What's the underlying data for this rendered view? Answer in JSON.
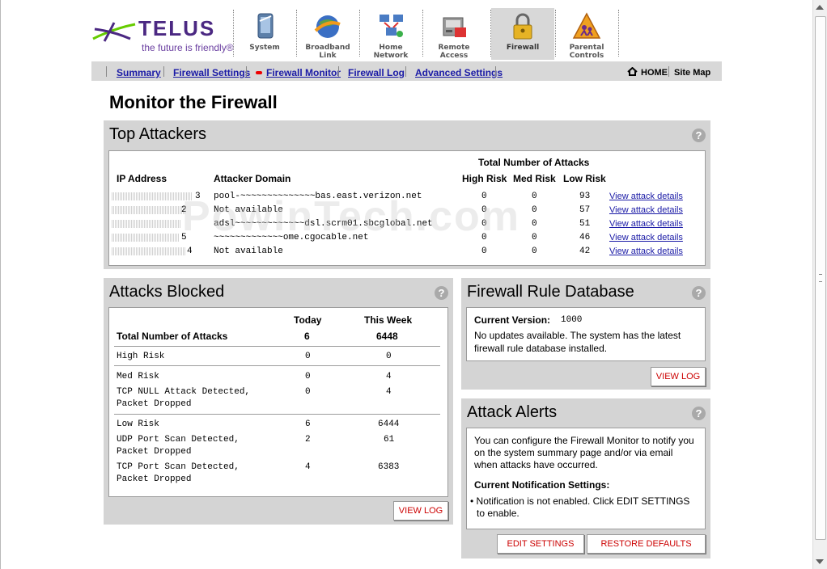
{
  "brand": {
    "name": "TELUS",
    "tagline": "the future is friendly®"
  },
  "main_nav": [
    {
      "label1": "System",
      "label2": "",
      "icon": "system-icon"
    },
    {
      "label1": "Broadband",
      "label2": "Link",
      "icon": "globe-icon"
    },
    {
      "label1": "Home",
      "label2": "Network",
      "icon": "network-icon"
    },
    {
      "label1": "Remote",
      "label2": "Access",
      "icon": "remote-icon"
    },
    {
      "label1": "Firewall",
      "label2": "",
      "icon": "lock-icon"
    },
    {
      "label1": "Parental",
      "label2": "Controls",
      "icon": "warning-icon"
    }
  ],
  "sub_nav": {
    "items": [
      "Summary",
      "Firewall Settings",
      "Firewall Monitor",
      "Firewall Log",
      "Advanced Settings"
    ],
    "home": "HOME",
    "sitemap": "Site Map"
  },
  "page_title": "Monitor the Firewall",
  "watermark": "PowinTech.com",
  "top_attackers": {
    "title": "Top Attackers",
    "help": "?",
    "group_header": "Total Number of Attacks",
    "col_ip": "IP Address",
    "col_domain": "Attacker Domain",
    "col_high": "High Risk",
    "col_med": "Med Risk",
    "col_low": "Low Risk",
    "rows": [
      {
        "ip_tail": "3",
        "domain": "pool-~~~~~~~~~~~~~~bas.east.verizon.net",
        "high": "0",
        "med": "0",
        "low": "93",
        "link": "View attack details"
      },
      {
        "ip_tail": "2",
        "domain": "Not available",
        "high": "0",
        "med": "0",
        "low": "57",
        "link": "View attack details"
      },
      {
        "ip_tail": "",
        "domain": "adsl~~~~~~~~~~~~~dsl.scrm01.sbcglobal.net",
        "high": "0",
        "med": "0",
        "low": "51",
        "link": "View attack details"
      },
      {
        "ip_tail": "5",
        "domain": "~~~~~~~~~~~~~ome.cgocable.net",
        "high": "0",
        "med": "0",
        "low": "46",
        "link": "View attack details"
      },
      {
        "ip_tail": "4",
        "domain": "Not available",
        "high": "0",
        "med": "0",
        "low": "42",
        "link": "View attack details"
      }
    ]
  },
  "attacks_blocked": {
    "title": "Attacks Blocked",
    "help": "?",
    "col_today": "Today",
    "col_week": "This Week",
    "total_label": "Total Number of Attacks",
    "total_today": "6",
    "total_week": "6448",
    "high_label": "High Risk",
    "high_today": "0",
    "high_week": "0",
    "med_label": "Med Risk",
    "med_today": "0",
    "med_week": "4",
    "tcp_null_1": "TCP NULL Attack Detected,",
    "tcp_null_2": "Packet Dropped",
    "tcp_null_today": "0",
    "tcp_null_week": "4",
    "low_label": "Low Risk",
    "low_today": "6",
    "low_week": "6444",
    "udp_1": "UDP Port Scan Detected,",
    "udp_2": "Packet Dropped",
    "udp_today": "2",
    "udp_week": "61",
    "tcp_1": "TCP Port Scan Detected,",
    "tcp_2": "Packet Dropped",
    "tcp_today": "4",
    "tcp_week": "6383",
    "view_log": "VIEW LOG"
  },
  "rule_db": {
    "title": "Firewall Rule Database",
    "help": "?",
    "version_label": "Current Version:",
    "version": "1000",
    "msg1": "No updates available. The system has the latest",
    "msg2": "firewall rule database installed.",
    "view_log": "VIEW LOG"
  },
  "attack_alerts": {
    "title": "Attack Alerts",
    "help": "?",
    "desc1": "You can configure the Firewall Monitor to notify you",
    "desc2": "on the system summary page and/or via email",
    "desc3": "when attacks have occurred.",
    "settings_label": "Current Notification Settings:",
    "bullet1": "• Notification is not enabled. Click EDIT SETTINGS",
    "bullet2": "to enable.",
    "edit_btn": "EDIT SETTINGS",
    "restore_btn": "RESTORE DEFAULTS"
  }
}
